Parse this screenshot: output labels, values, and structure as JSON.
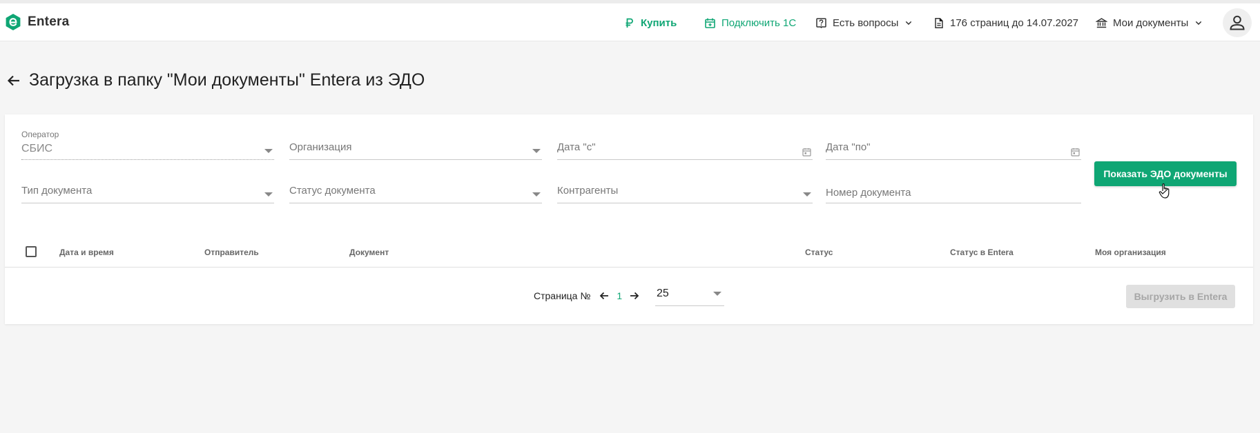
{
  "app": {
    "logo_text": "Entera",
    "brand_color": "#0fa674"
  },
  "header": {
    "buy_label": "Купить",
    "connect_label": "Подключить 1С",
    "questions_label": "Есть вопросы",
    "pages_label": "176 страниц до 14.07.2027",
    "docs_label": "Мои документы"
  },
  "page": {
    "title": "Загрузка в папку \"Мои документы\" Entera из ЭДО"
  },
  "filters": {
    "operator": {
      "label": "Оператор",
      "value": "СБИС"
    },
    "organization": {
      "placeholder": "Организация"
    },
    "date_from": {
      "placeholder": "Дата \"с\""
    },
    "date_to": {
      "placeholder": "Дата \"по\""
    },
    "doc_type": {
      "placeholder": "Тип документа"
    },
    "doc_status": {
      "placeholder": "Статус документа"
    },
    "counterparties": {
      "placeholder": "Контрагенты"
    },
    "doc_number": {
      "placeholder": "Номер документа"
    },
    "show_button": "Показать ЭДО документы"
  },
  "table": {
    "columns": [
      "Дата и время",
      "Отправитель",
      "Документ",
      "Статус",
      "Статус в Entera",
      "Моя организация"
    ]
  },
  "pagination": {
    "label": "Страница №",
    "current_page": "1",
    "per_page": "25",
    "export_button": "Выгрузить в Entera"
  }
}
